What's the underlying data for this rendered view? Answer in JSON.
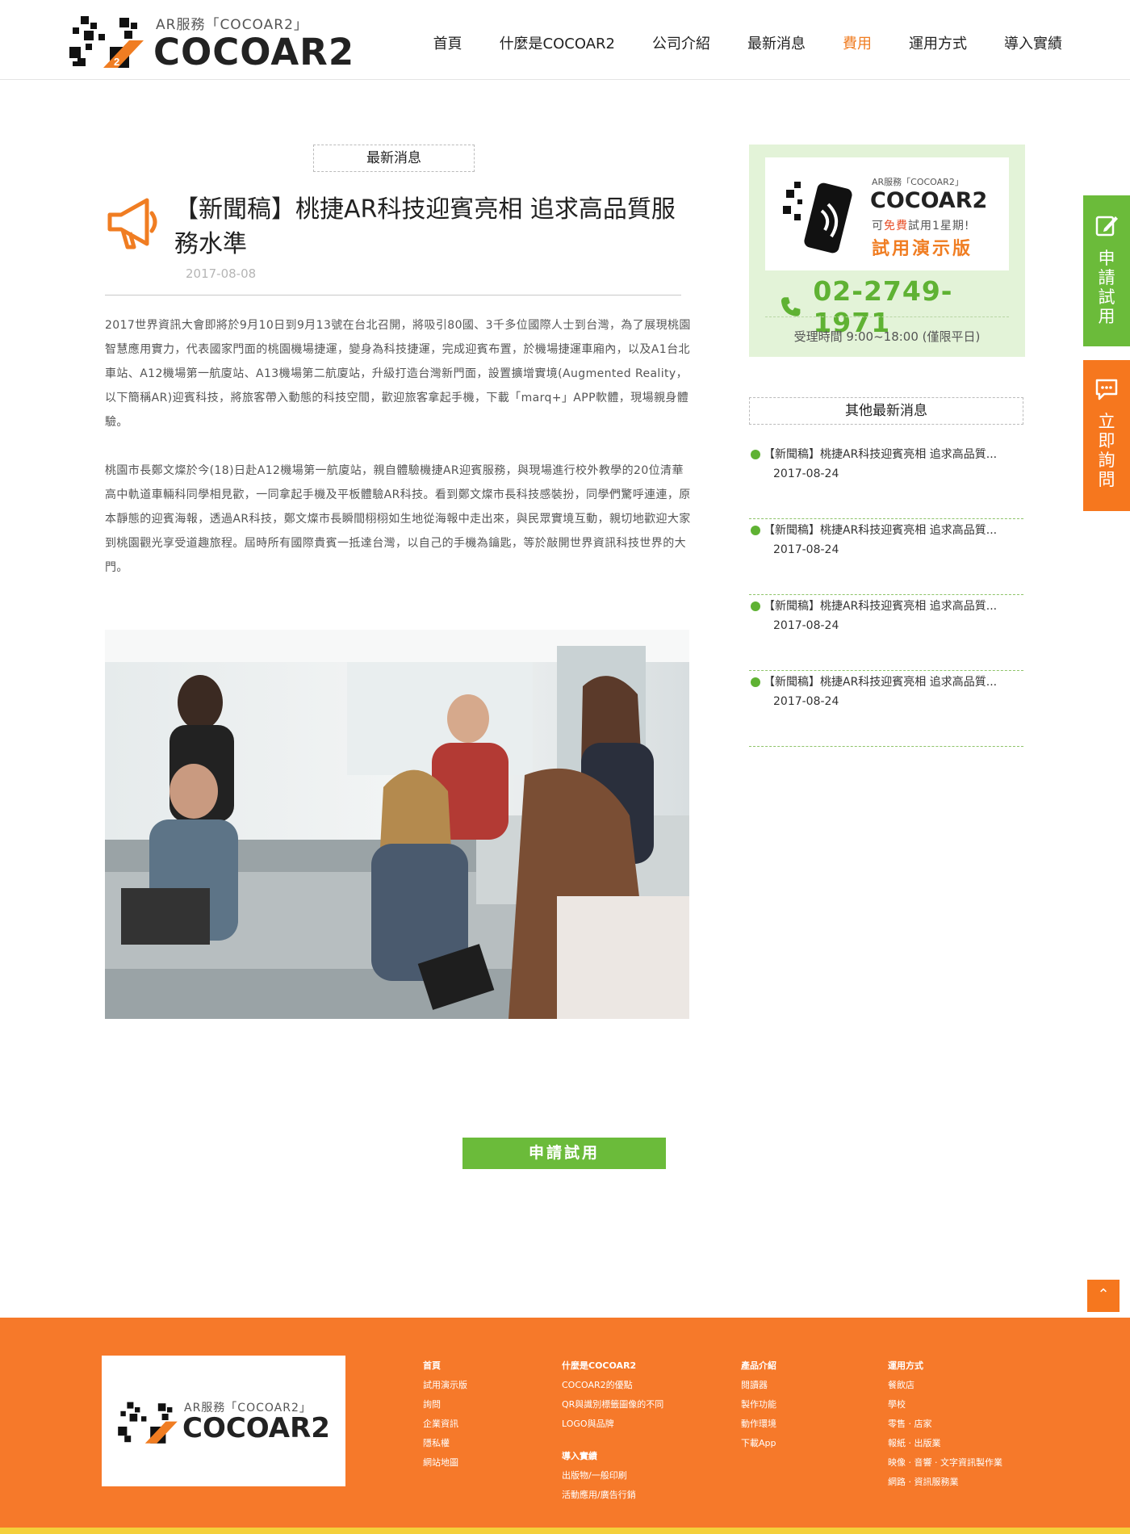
{
  "header": {
    "logo_sub": "AR服務「COCOAR2」",
    "logo_main": "COCOAR2",
    "nav": [
      {
        "label": "首頁"
      },
      {
        "label": "什麼是COCOAR2"
      },
      {
        "label": "公司介紹"
      },
      {
        "label": "最新消息"
      },
      {
        "label": "費用"
      },
      {
        "label": "運用方式"
      },
      {
        "label": "導入實績"
      }
    ]
  },
  "side_tabs": {
    "apply": "申請試用",
    "inquiry": "立即詢問"
  },
  "article": {
    "category": "最新消息",
    "title": "【新聞稿】桃捷AR科技迎賓亮相 追求高品質服務水準",
    "date": "2017-08-08",
    "paragraphs": [
      "2017世界資訊大會即將於9月10日到9月13號在台北召開，將吸引80國、3千多位國際人士到台灣，為了展現桃園智慧應用實力，代表國家門面的桃園機場捷運，變身為科技捷運，完成迎賓布置，於機場捷運車廂內，以及A1台北車站、A12機場第一航廈站、A13機場第二航廈站，升級打造台灣新門面，設置擴增實境(Augmented Reality，以下簡稱AR)迎賓科技，將旅客帶入動態的科技空間，歡迎旅客拿起手機，下載「marq+」APP軟體，現場親身體驗。",
      "桃園市長鄭文燦於今(18)日赴A12機場第一航廈站，親自體驗機捷AR迎賓服務，與現場進行校外教學的20位清華高中軌道車輛科同學相見歡，一同拿起手機及平板體驗AR科技。看到鄭文燦市長科技感裝扮，同學們驚呼連連，原本靜態的迎賓海報，透過AR科技，鄭文燦市長瞬間栩栩如生地從海報中走出來，與民眾實境互動，親切地歡迎大家到桃園觀光享受道趣旅程。屆時所有國際貴賓一抵達台灣，以自己的手機為鑰匙，等於敲開世界資訊科技世界的大門。"
    ]
  },
  "apply_button": "申請試用",
  "sidebar": {
    "promo": {
      "sub": "AR服務「COCOAR2」",
      "brand": "COCOAR2",
      "free_pre": "可",
      "free_hl": "免費",
      "free_post": "試用1星期!",
      "demo": "試用演示版",
      "phone": "02-2749-1971",
      "hours": "受理時間  9:00~18:00  (僅限平日)"
    },
    "other_title": "其他最新消息",
    "news": [
      {
        "title": "【新聞稿】桃捷AR科技迎賓亮相 追求高品質...",
        "date": "2017-08-24"
      },
      {
        "title": "【新聞稿】桃捷AR科技迎賓亮相 追求高品質...",
        "date": "2017-08-24"
      },
      {
        "title": "【新聞稿】桃捷AR科技迎賓亮相 追求高品質...",
        "date": "2017-08-24"
      },
      {
        "title": "【新聞稿】桃捷AR科技迎賓亮相 追求高品質...",
        "date": "2017-08-24"
      }
    ]
  },
  "footer": {
    "logo_sub": "AR服務「COCOAR2」",
    "logo_main": "COCOAR2",
    "col1": [
      "首頁",
      "試用演示版",
      "詢問",
      "企業資訊",
      "隱私權",
      "網站地圖"
    ],
    "col2a": [
      "什麼是COCOAR2",
      "COCOAR2的優點",
      "QR與識別標籤圖像的不同",
      "LOGO與品牌"
    ],
    "col2b": [
      "導入實績",
      "出版物/一般印刷",
      "活動應用/廣告行銷"
    ],
    "col3": [
      "產品介紹",
      "閱讀器",
      "製作功能",
      "動作環境",
      "下載App"
    ],
    "col4": [
      "運用方式",
      "餐飲店",
      "學校",
      "零售 · 店家",
      "報紙 · 出版業",
      "映像 · 音響 · 文字資訊製作業",
      "網路 · 資訊服務業"
    ]
  },
  "colors": {
    "accent_orange": "#f6771e",
    "accent_green": "#6bbb3a",
    "footer_bar": "#f4d03a"
  }
}
